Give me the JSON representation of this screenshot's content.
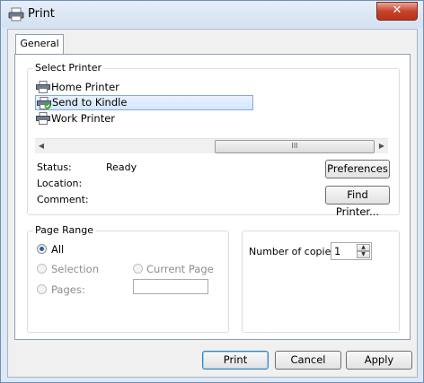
{
  "window": {
    "title": "Print",
    "close_glyph": "✕"
  },
  "tabs": [
    {
      "label": "General"
    }
  ],
  "select_printer": {
    "group_label": "Select Printer",
    "printers": [
      {
        "label": "Home Printer",
        "icon": "printer-icon",
        "selected": false
      },
      {
        "label": "Send to Kindle",
        "icon": "printer-icon",
        "selected": true
      },
      {
        "label": "Work Printer",
        "icon": "printer-icon",
        "selected": false
      }
    ],
    "scroll_thumb_glyph": "III",
    "status_label": "Status:",
    "status_value": "Ready",
    "location_label": "Location:",
    "comment_label": "Comment:",
    "preferences_button": "Preferences",
    "find_printer_button": "Find Printer..."
  },
  "page_range": {
    "group_label": "Page Range",
    "all": "All",
    "selection": "Selection",
    "current_page": "Current Page",
    "pages": "Pages:"
  },
  "copies": {
    "label": "Number of copies:",
    "value": "1"
  },
  "buttons": {
    "print": "Print",
    "cancel": "Cancel",
    "apply": "Apply"
  },
  "colors": {
    "title_bar": "#d4e1f1",
    "close_button": "#c7432b",
    "selection_highlight": "#d4e6fb",
    "default_button_border": "#3c7fb1"
  }
}
